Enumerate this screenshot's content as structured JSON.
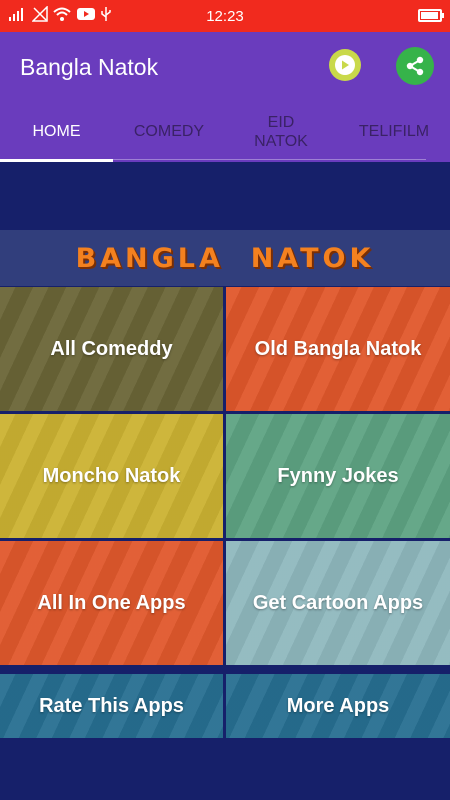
{
  "status_bar": {
    "time": "12:23",
    "battery_level": 0.95,
    "color": "#f12a1e"
  },
  "app_bar": {
    "title": "Bangla Natok",
    "color": "#6a3cbd"
  },
  "tabs": [
    {
      "label": "HOME",
      "active": true
    },
    {
      "label": "COMEDY",
      "active": false
    },
    {
      "label": "EID NATOK",
      "active": false
    },
    {
      "label": "TELIFILM",
      "active": false
    }
  ],
  "banner": {
    "text": "BANGLA  NATOK"
  },
  "tiles": [
    {
      "label": "All Comeddy",
      "color": "#6a6537"
    },
    {
      "label": "Old Bangla Natok",
      "color": "#e0572b"
    },
    {
      "label": "Moncho Natok",
      "color": "#cbb232"
    },
    {
      "label": "Fynny Jokes",
      "color": "#5ea383"
    },
    {
      "label": "All In One Apps",
      "color": "#e0582c"
    },
    {
      "label": "Get Cartoon Apps",
      "color": "#8fb8be"
    },
    {
      "label": "Rate This Apps",
      "color": "#276f91"
    },
    {
      "label": "More Apps",
      "color": "#276f91"
    }
  ],
  "icons": {
    "play": "play-circle-icon",
    "share": "share-icon"
  }
}
